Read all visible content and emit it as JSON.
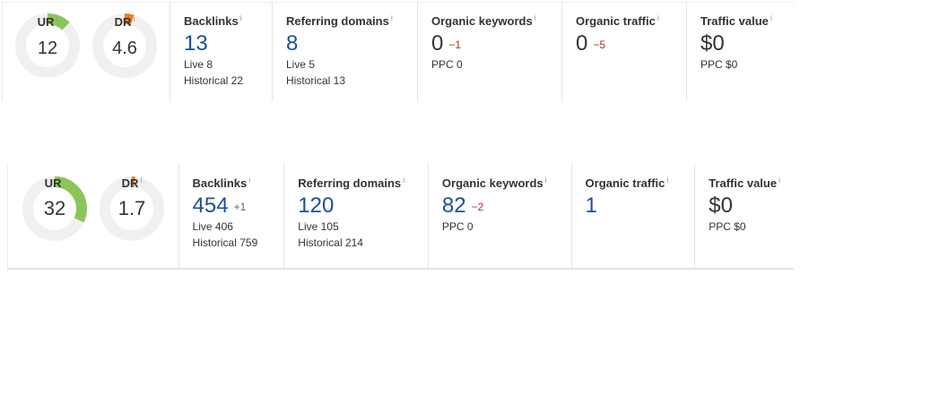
{
  "rows": [
    {
      "ur": {
        "label": "UR",
        "info": "i",
        "value": "12",
        "fraction": 0.12,
        "color": "#8cc65b"
      },
      "dr": {
        "label": "DR",
        "info": "i",
        "value": "4.6",
        "fraction": 0.046,
        "color": "#ef7d1a"
      },
      "backlinks": {
        "title": "Backlinks",
        "info": "i",
        "value": "13",
        "delta": "",
        "live": "Live 8",
        "historical": "Historical 22"
      },
      "referring_domains": {
        "title": "Referring domains",
        "info": "i",
        "value": "8",
        "live": "Live 5",
        "historical": "Historical 13"
      },
      "organic_keywords": {
        "title": "Organic keywords",
        "info": "i",
        "value": "0",
        "delta": "−1",
        "ppc": "PPC 0"
      },
      "organic_traffic": {
        "title": "Organic traffic",
        "info": "i",
        "value": "0",
        "delta": "−5"
      },
      "traffic_value": {
        "title": "Traffic value",
        "info": "i",
        "value": "$0",
        "ppc": "PPC $0"
      }
    },
    {
      "ur": {
        "label": "UR",
        "info": "i",
        "value": "32",
        "fraction": 0.32,
        "color": "#8cc65b"
      },
      "dr": {
        "label": "DR",
        "info": "i",
        "value": "1.7",
        "fraction": 0.017,
        "color": "#ef7d1a"
      },
      "backlinks": {
        "title": "Backlinks",
        "info": "i",
        "value": "454",
        "delta": "+1",
        "live": "Live 406",
        "historical": "Historical 759"
      },
      "referring_domains": {
        "title": "Referring domains",
        "info": "i",
        "value": "120",
        "live": "Live 105",
        "historical": "Historical 214"
      },
      "organic_keywords": {
        "title": "Organic keywords",
        "info": "i",
        "value": "82",
        "delta": "−2",
        "ppc": "PPC 0"
      },
      "organic_traffic": {
        "title": "Organic traffic",
        "info": "i",
        "value": "1",
        "delta": ""
      },
      "traffic_value": {
        "title": "Traffic value",
        "info": "i",
        "value": "$0",
        "ppc": "PPC $0"
      }
    }
  ]
}
